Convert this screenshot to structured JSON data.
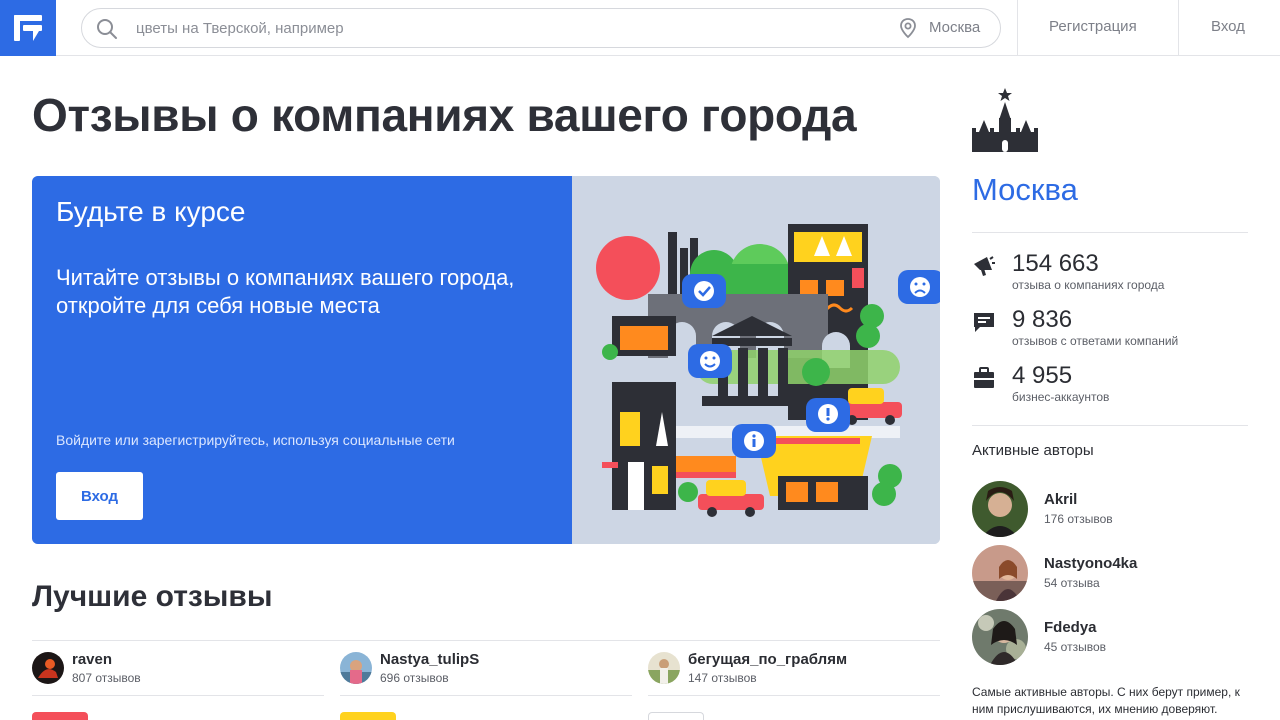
{
  "colors": {
    "brand": "#2d6be4",
    "text": "#2e3038",
    "muted": "#7d8089",
    "divider": "#e3e4e8"
  },
  "header": {
    "logo_icon": "flamp-logo-icon",
    "search_placeholder": "цветы на Тверской, например",
    "city": "Москва",
    "register_label": "Регистрация",
    "login_label": "Вход"
  },
  "main": {
    "title": "Отзывы о компаниях вашего города",
    "promo": {
      "heading": "Будьте в курсе",
      "text": "Читайте отзывы о компаниях вашего города, откройте для себя новые места",
      "social_text": "Войдите или зарегистрируйтесь, используя социальные сети",
      "login_button": "Вход"
    },
    "best_reviews_title": "Лучшие отзывы",
    "reviewers": [
      {
        "name": "raven",
        "count": "807 отзывов"
      },
      {
        "name": "Nastya_tulipS",
        "count": "696 отзывов"
      },
      {
        "name": "бегущая_по_граблям",
        "count": "147 отзывов"
      }
    ]
  },
  "sidebar": {
    "city_name": "Москва",
    "stats": [
      {
        "icon": "megaphone-icon",
        "value": "154 663",
        "label": "отзыва о компаниях города"
      },
      {
        "icon": "chat-icon",
        "value": "9 836",
        "label": "отзывов с ответами компаний"
      },
      {
        "icon": "briefcase-icon",
        "value": "4 955",
        "label": "бизнес-аккаунтов"
      }
    ],
    "active_authors_title": "Активные авторы",
    "authors": [
      {
        "name": "Akril",
        "count": "176 отзывов"
      },
      {
        "name": "Nastyono4ka",
        "count": "54 отзыва"
      },
      {
        "name": "Fdedya",
        "count": "45 отзывов"
      }
    ],
    "note": "Самые активные авторы. С них берут пример, к ним прислушиваются, их мнению доверяют."
  }
}
